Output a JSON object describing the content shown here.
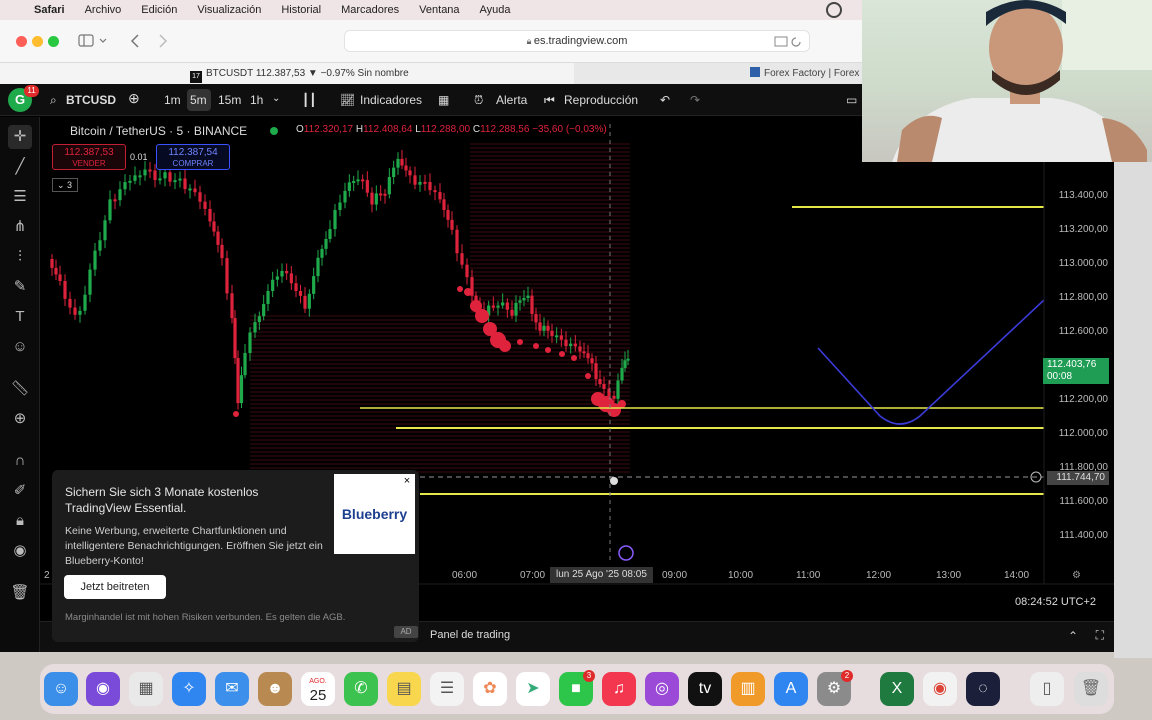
{
  "menubar": {
    "items": [
      "Safari",
      "Archivo",
      "Edición",
      "Visualización",
      "Historial",
      "Marcadores",
      "Ventana",
      "Ayuda"
    ]
  },
  "browser": {
    "url": "es.tradingview.com",
    "tab_active": "BTCUSDT 112.387,53 ▼ −0.97% Sin nombre",
    "tab_other": "Forex Factory | Forex m"
  },
  "tv": {
    "badge_count": "11",
    "symbol": "BTCUSD",
    "timeframes": [
      "1m",
      "5m",
      "15m",
      "1h"
    ],
    "indicators": "Indicadores",
    "alert": "Alerta",
    "replay": "Reproducción",
    "title": "Bitcoin / TetherUS · 5 · BINANCE",
    "ohlc": {
      "o_label": "O",
      "o": "112.320,17",
      "h_label": "H",
      "h": "112.408,64",
      "l_label": "L",
      "l": "112.288,00",
      "c_label": "C",
      "c": "112.288,56",
      "chg": "−35,60 (−0,03%)"
    },
    "sell": {
      "price": "112.387,53",
      "label": "VENDER"
    },
    "buy": {
      "price": "112.387,54",
      "label": "COMPRAR"
    },
    "spread": "0.01",
    "count": "3",
    "price_axis": [
      "113.400,00",
      "113.200,00",
      "113.000,00",
      "112.800,00",
      "112.600,00",
      "112.200,00",
      "112.000,00",
      "111.800,00",
      "111.600,00",
      "111.400,00"
    ],
    "current_price": "112.403,76",
    "current_timer": "00:08",
    "cross_price": "111.744,70",
    "time_axis": [
      "06:00",
      "07:00",
      "09:00",
      "10:00",
      "11:00",
      "12:00",
      "13:00",
      "14:00"
    ],
    "cross_time": "lun 25 Ago '25   08:05",
    "clock": "08:24:52 UTC+2",
    "panel": "Panel de trading",
    "axis_left_digit": "2"
  },
  "promo": {
    "headline": "Sichern Sie sich 3 Monate kostenlos TradingView Essential.",
    "body": "Keine Werbung, erweiterte Chartfunktionen und intelligentere Benachrichtigungen. Eröffnen Sie jetzt ein Blueberry-Konto!",
    "button": "Jetzt beitreten",
    "footer": "Marginhandel ist mit hohen Risiken verbunden. Es gelten die AGB.",
    "ad": "AD",
    "logo": "Blueberry",
    "close": "×"
  },
  "dock": {
    "calendar_month": "AGO.",
    "calendar_day": "25",
    "facetime_badge": "3",
    "settings_badge": "2"
  },
  "colors": {
    "up": "#1faa4c",
    "down": "#e0233c",
    "yellow_level": "#e6e84a",
    "projection": "#3b3bd8"
  }
}
